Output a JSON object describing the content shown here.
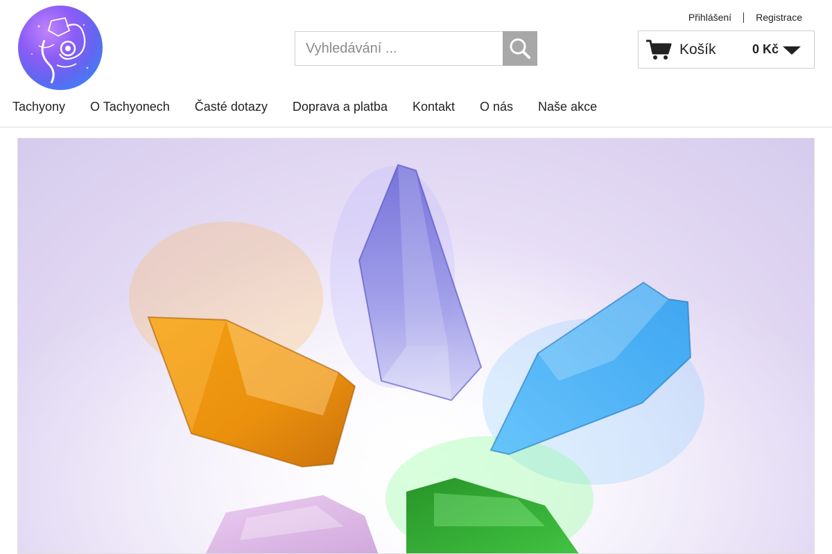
{
  "account": {
    "login_label": "Přihlášení",
    "register_label": "Registrace"
  },
  "search": {
    "placeholder": "Vyhledávání ...",
    "value": "",
    "button_icon": "search-icon"
  },
  "cart": {
    "label": "Košík",
    "total": "0 Kč",
    "icon": "cart-icon",
    "dropdown_icon": "chevron-down-icon"
  },
  "nav": {
    "items": [
      {
        "label": "Tachyony"
      },
      {
        "label": "O Tachyonech"
      },
      {
        "label": "Časté dotazy"
      },
      {
        "label": "Doprava a platba"
      },
      {
        "label": "Kontakt"
      },
      {
        "label": "O nás"
      },
      {
        "label": "Naše akce"
      }
    ]
  },
  "colors": {
    "search_button": "#a8a8a8",
    "border": "#cfcfcf",
    "text": "#222222"
  }
}
